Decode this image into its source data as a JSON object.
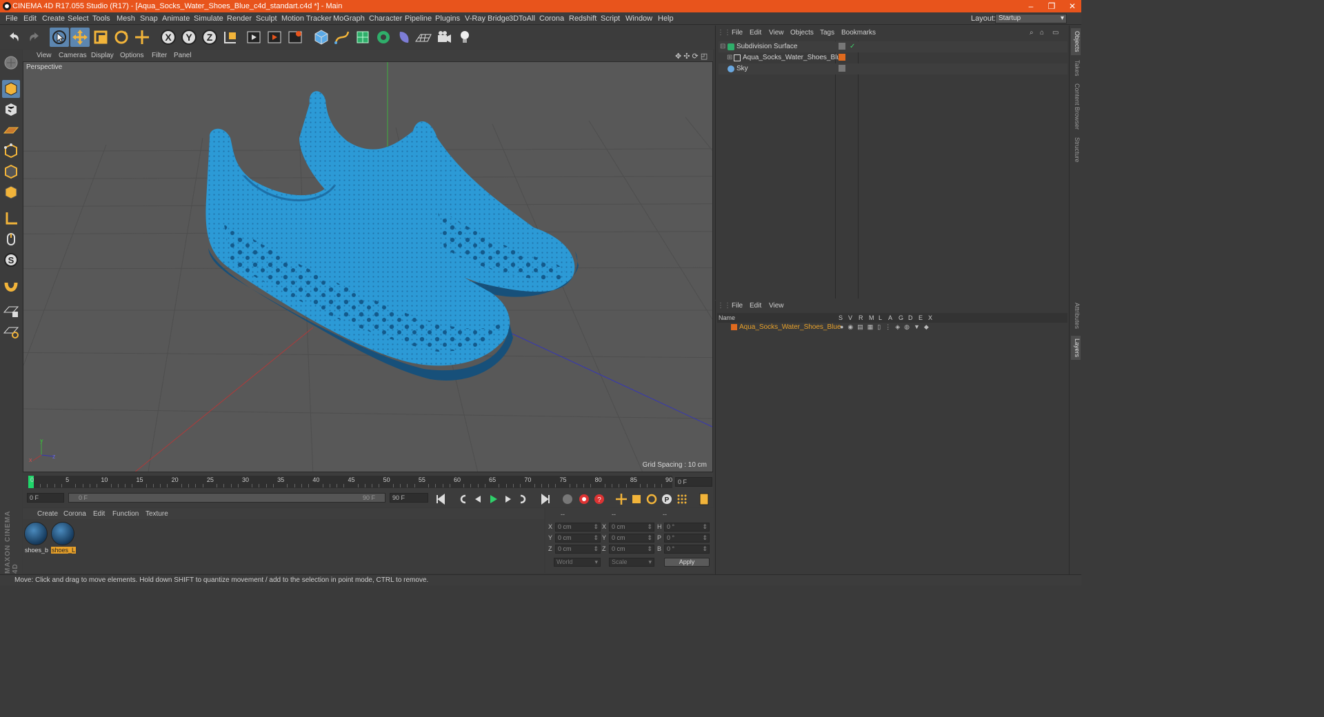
{
  "window": {
    "title": "CINEMA 4D R17.055 Studio (R17) - [Aqua_Socks_Water_Shoes_Blue_c4d_standart.c4d *] - Main",
    "controls": [
      "–",
      "❐",
      "✕"
    ]
  },
  "menubar": {
    "items": [
      "File",
      "Edit",
      "Create",
      "Select",
      "Tools",
      "Mesh",
      "Snap",
      "Animate",
      "Simulate",
      "Render",
      "Sculpt",
      "Motion Tracker",
      "MoGraph",
      "Character",
      "Pipeline",
      "Plugins",
      "V-Ray Bridge",
      "3DToAll",
      "Corona",
      "Redshift",
      "Script",
      "Window",
      "Help"
    ],
    "layout_label": "Layout:",
    "layout_value": "Startup"
  },
  "viewport": {
    "menu": [
      "View",
      "Cameras",
      "Display",
      "Options",
      "Filter",
      "Panel"
    ],
    "label": "Perspective",
    "grid_spacing": "Grid Spacing : 10 cm",
    "axis_labels": {
      "y": "y",
      "x": "x",
      "z": "z"
    }
  },
  "timeline": {
    "ticks": [
      "0",
      "5",
      "10",
      "15",
      "20",
      "25",
      "30",
      "35",
      "40",
      "45",
      "50",
      "55",
      "60",
      "65",
      "70",
      "75",
      "80",
      "85",
      "90"
    ],
    "current_frame": "0 F"
  },
  "transport": {
    "start": "0 F",
    "range_start": "0 F",
    "range_end": "90 F",
    "end": "90 F"
  },
  "materials": {
    "menu": [
      "Create",
      "Corona",
      "Edit",
      "Function",
      "Texture"
    ],
    "items": [
      {
        "label": "shoes_b",
        "selected": false
      },
      {
        "label": "shoes_L",
        "selected": true
      }
    ]
  },
  "coords": {
    "headers": [
      "--",
      "--",
      "--"
    ],
    "rows": [
      {
        "a": "X",
        "av": "0 cm",
        "b": "X",
        "bv": "0 cm",
        "c": "H",
        "cv": "0 °"
      },
      {
        "a": "Y",
        "av": "0 cm",
        "b": "Y",
        "bv": "0 cm",
        "c": "P",
        "cv": "0 °"
      },
      {
        "a": "Z",
        "av": "0 cm",
        "b": "Z",
        "bv": "0 cm",
        "c": "B",
        "cv": "0 °"
      }
    ],
    "world": "World",
    "scale": "Scale",
    "apply": "Apply"
  },
  "objects": {
    "menu": [
      "File",
      "Edit",
      "View",
      "Objects",
      "Tags",
      "Bookmarks"
    ],
    "items": [
      {
        "name": "Subdivision Surface",
        "indent": 0
      },
      {
        "name": "Aqua_Socks_Water_Shoes_Blue",
        "indent": 1
      },
      {
        "name": "Sky",
        "indent": 0
      }
    ]
  },
  "layers": {
    "menu": [
      "File",
      "Edit",
      "View"
    ],
    "columns": [
      "Name",
      "S",
      "V",
      "R",
      "M",
      "L",
      "A",
      "G",
      "D",
      "E",
      "X"
    ],
    "row": "Aqua_Socks_Water_Shoes_Blue"
  },
  "right_tabs": [
    "Objects",
    "Takes",
    "Content Browser",
    "Structure",
    "Attributes",
    "Layers"
  ],
  "status": "Move: Click and drag to move elements. Hold down SHIFT to quantize movement / add to the selection in point mode, CTRL to remove.",
  "brand": "MAXON CINEMA 4D",
  "colors": {
    "title_bar": "#e8541c",
    "selection": "#5c86b0",
    "shoe": "#2c9ad6",
    "layer_orange": "#e8a12a"
  }
}
